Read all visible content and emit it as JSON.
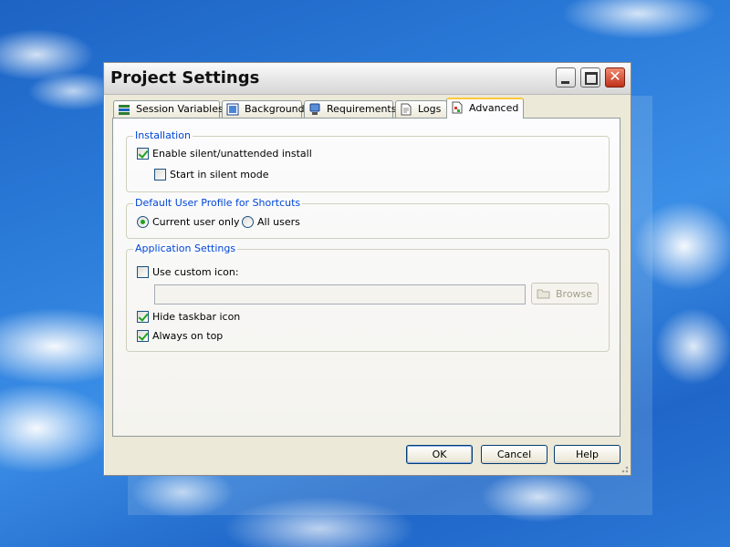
{
  "window": {
    "title": "Project Settings"
  },
  "tabs": [
    {
      "label": "Session Variables",
      "icon": "session-variables-icon"
    },
    {
      "label": "Background",
      "icon": "background-icon"
    },
    {
      "label": "Requirements",
      "icon": "requirements-icon"
    },
    {
      "label": "Logs",
      "icon": "logs-icon"
    },
    {
      "label": "Advanced",
      "icon": "advanced-icon",
      "active": true
    }
  ],
  "installation": {
    "group_title": "Installation",
    "enable_silent_label": "Enable silent/unattended install",
    "enable_silent_checked": true,
    "start_silent_label": "Start in silent mode",
    "start_silent_checked": false
  },
  "profile": {
    "group_title": "Default User Profile for Shortcuts",
    "current_user_label": "Current user only",
    "all_users_label": "All users",
    "selected": "Current user only"
  },
  "app_settings": {
    "group_title": "Application Settings",
    "custom_icon_label": "Use custom icon:",
    "custom_icon_checked": false,
    "icon_path_value": "",
    "browse_label": "Browse",
    "hide_taskbar_label": "Hide taskbar icon",
    "hide_taskbar_checked": true,
    "always_on_top_label": "Always on top",
    "always_on_top_checked": true
  },
  "footer": {
    "ok_label": "OK",
    "cancel_label": "Cancel",
    "help_label": "Help"
  },
  "colors": {
    "group_title": "#0046d5",
    "active_tab_accent": "#ffc83c",
    "check": "#21a121"
  }
}
